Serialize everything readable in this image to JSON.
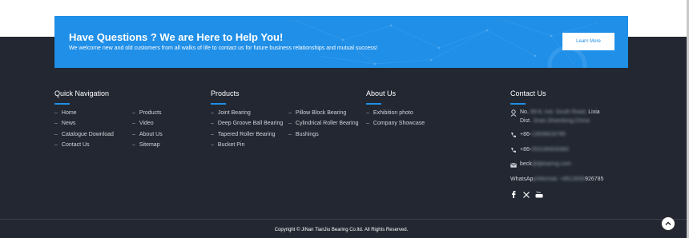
{
  "banner": {
    "title": "Have Questions ? We are Here to Help You!",
    "subtitle": "We welcome new and old customers from all walks of life to contact us for future business relationships and mutual success!",
    "button_label": "Learn More"
  },
  "quick_nav": {
    "heading": "Quick Navigation",
    "col1": [
      "Home",
      "News",
      "Catalogue Download",
      "Contact Us"
    ],
    "col2": [
      "Products",
      "Video",
      "About Us",
      "Sitemap"
    ]
  },
  "products": {
    "heading": "Products",
    "col1": [
      "Joint Bearing",
      "Deep Groove Ball Bearing",
      "Tapered Roller Bearing",
      "Bucket Pin"
    ],
    "col2": [
      "Pillow Block Bearing",
      "Cylindrical Roller Bearing",
      "Bushings"
    ]
  },
  "about": {
    "heading": "About Us",
    "items": [
      "Exhibition photo",
      "Company Showcase"
    ]
  },
  "contact": {
    "heading": "Contact Us",
    "address_prefix": "No.",
    "address_blur1": "89-8, Ind. South Road,",
    "address_visible1": "Lixia",
    "address_line2_prefix": "Dist.",
    "address_blur2": "Jinan,Shandong,China",
    "phone1_prefix": "+86-",
    "phone1_blur": "13508626785",
    "phone2_prefix": "+86-",
    "phone2_blur": "053185826383",
    "email_prefix": "beck",
    "email_blur": "@tjbearing.com",
    "whatsapp_prefix": "WhatsAp",
    "whatsapp_blur": "p/Wechat: +8613508",
    "whatsapp_suffix": "926785"
  },
  "social_icons": [
    "facebook-icon",
    "x-twitter-icon",
    "youtube-icon"
  ],
  "footer": {
    "copyright": "Copyright © JiNan TianJiu Bearing Co.ltd. All Rights Reserved."
  },
  "colors": {
    "accent": "#1f8fe8",
    "footer_bg": "#222731"
  }
}
